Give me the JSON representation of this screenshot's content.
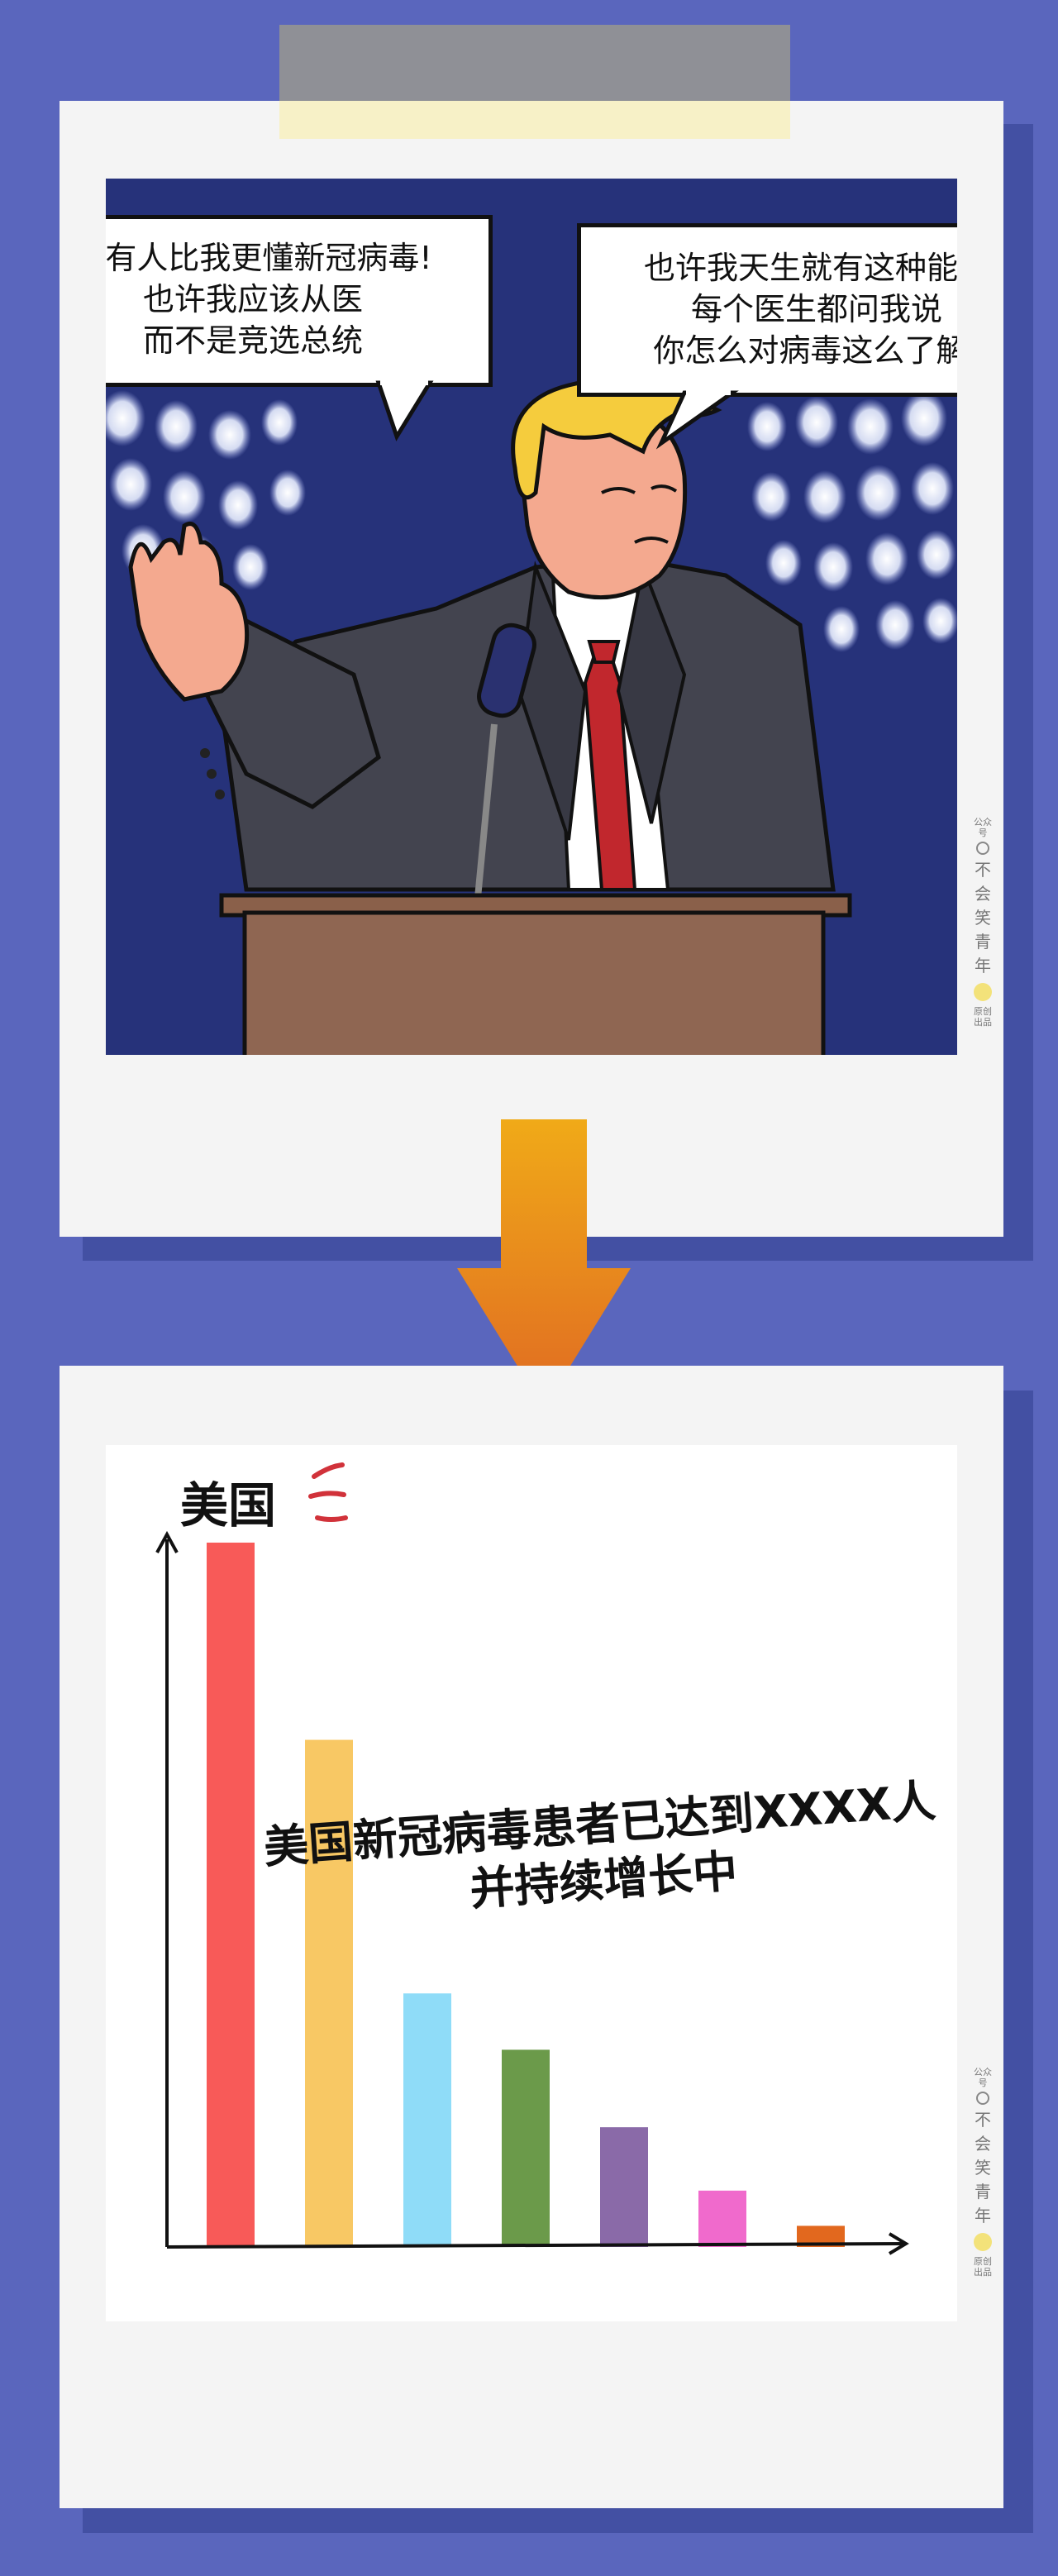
{
  "comic": {
    "bubble_left": [
      "没有人比我更懂新冠病毒!",
      "也许我应该从医",
      "而不是竞选总统"
    ],
    "bubble_right": [
      "也许我天生就有这种能力",
      "每个医生都问我说",
      "你怎么对病毒这么了解!"
    ]
  },
  "watermark": {
    "top": "公众号",
    "name": [
      "不",
      "会",
      "笑",
      "青",
      "年"
    ],
    "bottom": "原创出品"
  },
  "chart_data": {
    "type": "bar",
    "title": "美国",
    "annotation": [
      "美国新冠病毒患者已达到XXXX人",
      "并持续增长中"
    ],
    "categories": [
      "",
      "",
      "",
      "",
      "",
      "",
      ""
    ],
    "values": [
      100,
      72,
      36,
      28,
      17,
      8,
      3
    ],
    "colors": [
      "#f85a58",
      "#f8c864",
      "#8fdcf8",
      "#6b9a4a",
      "#8a6aa8",
      "#f06acc",
      "#e2681e"
    ],
    "ylim": [
      0,
      100
    ],
    "grid": false,
    "legend": "none"
  },
  "colors": {
    "background": "#5a66bd",
    "card": "#f4f4f4",
    "arrow_top": "#f0aa18",
    "arrow_bottom": "#e06a22"
  }
}
